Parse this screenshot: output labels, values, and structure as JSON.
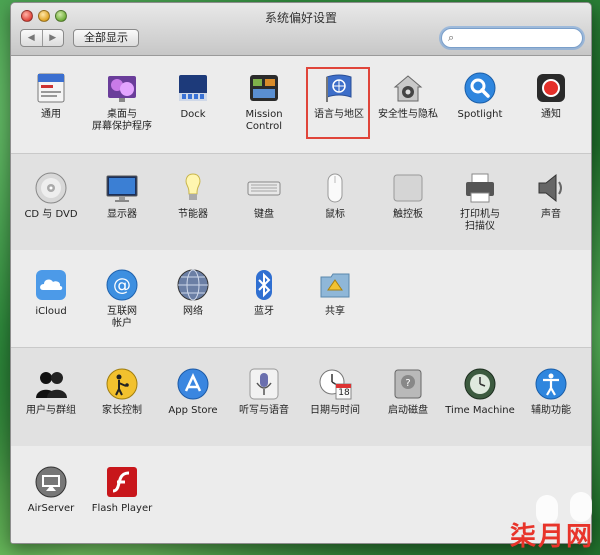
{
  "window": {
    "title": "系统偏好设置",
    "back_icon": "back-arrow-icon",
    "forward_icon": "forward-arrow-icon",
    "show_all_label": "全部显示",
    "search": {
      "value": "",
      "placeholder": ""
    }
  },
  "rows": [
    {
      "items": [
        {
          "id": "general",
          "label": "通用",
          "icon": "general-file-icon"
        },
        {
          "id": "desktop",
          "label": "桌面与",
          "label2": "屏幕保护程序",
          "icon": "desktop-screensaver-icon"
        },
        {
          "id": "dock",
          "label": "Dock",
          "icon": "dock-icon"
        },
        {
          "id": "mission-control",
          "label": "Mission",
          "label2": "Control",
          "icon": "mission-control-icon"
        },
        {
          "id": "language",
          "label": "语言与地区",
          "icon": "language-region-flag-icon",
          "highlighted": true
        },
        {
          "id": "security",
          "label": "安全性与隐私",
          "icon": "security-house-icon"
        },
        {
          "id": "spotlight",
          "label": "Spotlight",
          "icon": "spotlight-magnifier-icon"
        },
        {
          "id": "notifications",
          "label": "通知",
          "icon": "notifications-icon"
        }
      ]
    },
    {
      "items": [
        {
          "id": "cd-dvd",
          "label": "CD 与 DVD",
          "icon": "cd-dvd-icon"
        },
        {
          "id": "displays",
          "label": "显示器",
          "icon": "display-monitor-icon"
        },
        {
          "id": "energy",
          "label": "节能器",
          "icon": "energy-bulb-icon"
        },
        {
          "id": "keyboard",
          "label": "键盘",
          "icon": "keyboard-icon"
        },
        {
          "id": "mouse",
          "label": "鼠标",
          "icon": "mouse-icon"
        },
        {
          "id": "trackpad",
          "label": "触控板",
          "icon": "trackpad-icon"
        },
        {
          "id": "printers",
          "label": "打印机与",
          "label2": "扫描仪",
          "icon": "printer-icon"
        },
        {
          "id": "sound",
          "label": "声音",
          "icon": "speaker-icon"
        }
      ]
    },
    {
      "items": [
        {
          "id": "icloud",
          "label": "iCloud",
          "icon": "icloud-icon"
        },
        {
          "id": "internet-accounts",
          "label": "互联网",
          "label2": "帐户",
          "icon": "at-sign-icon"
        },
        {
          "id": "network",
          "label": "网络",
          "icon": "network-globe-icon"
        },
        {
          "id": "bluetooth",
          "label": "蓝牙",
          "icon": "bluetooth-icon"
        },
        {
          "id": "sharing",
          "label": "共享",
          "icon": "sharing-folder-icon"
        }
      ]
    },
    {
      "items": [
        {
          "id": "users",
          "label": "用户与群组",
          "icon": "users-silhouette-icon"
        },
        {
          "id": "parental",
          "label": "家长控制",
          "icon": "parental-controls-icon"
        },
        {
          "id": "app-store",
          "label": "App Store",
          "icon": "app-store-icon"
        },
        {
          "id": "dictation",
          "label": "听写与语音",
          "icon": "microphone-icon"
        },
        {
          "id": "date-time",
          "label": "日期与时间",
          "icon": "clock-calendar-icon",
          "badge": "18"
        },
        {
          "id": "startup-disk",
          "label": "启动磁盘",
          "icon": "startup-disk-icon"
        },
        {
          "id": "time-machine",
          "label": "Time Machine",
          "icon": "time-machine-icon"
        },
        {
          "id": "accessibility",
          "label": "辅助功能",
          "icon": "accessibility-icon"
        }
      ]
    },
    {
      "items": [
        {
          "id": "airserver",
          "label": "AirServer",
          "icon": "airserver-icon"
        },
        {
          "id": "flash",
          "label": "Flash Player",
          "icon": "flash-player-icon"
        }
      ]
    }
  ],
  "watermark": "柒月网"
}
